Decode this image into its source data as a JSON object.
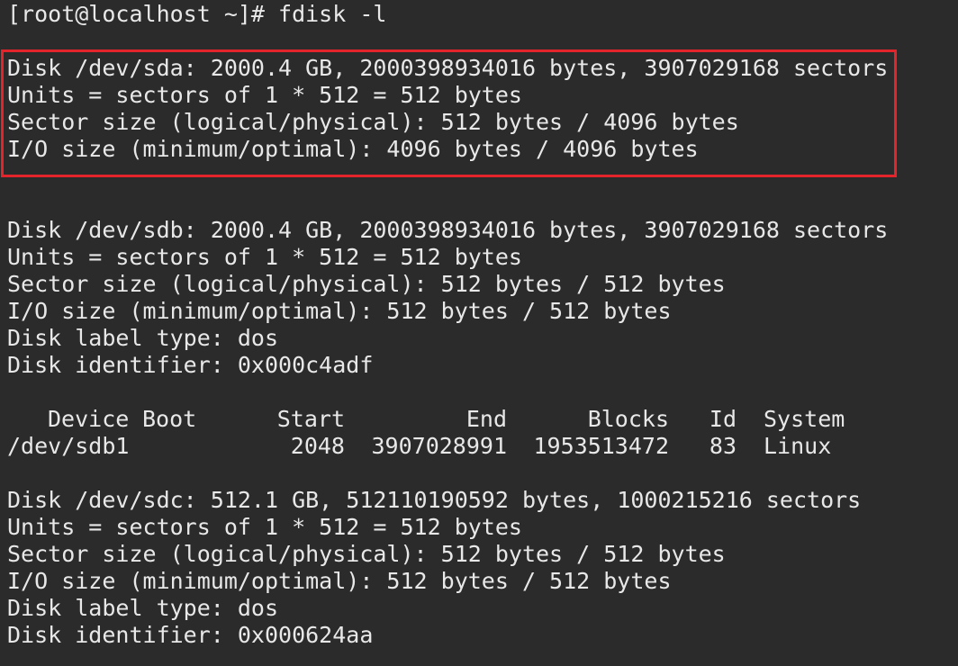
{
  "terminal": {
    "prompt": "[root@localhost ~]# fdisk -l",
    "highlight_color": "#e3242b",
    "sda": {
      "disk": "Disk /dev/sda: 2000.4 GB, 2000398934016 bytes, 3907029168 sectors",
      "units": "Units = sectors of 1 * 512 = 512 bytes",
      "sector_size": "Sector size (logical/physical): 512 bytes / 4096 bytes",
      "io_size": "I/O size (minimum/optimal): 4096 bytes / 4096 bytes"
    },
    "sdb": {
      "disk": "Disk /dev/sdb: 2000.4 GB, 2000398934016 bytes, 3907029168 sectors",
      "units": "Units = sectors of 1 * 512 = 512 bytes",
      "sector_size": "Sector size (logical/physical): 512 bytes / 512 bytes",
      "io_size": "I/O size (minimum/optimal): 512 bytes / 512 bytes",
      "label_type": "Disk label type: dos",
      "identifier": "Disk identifier: 0x000c4adf"
    },
    "partition_table": {
      "headers": {
        "device": "Device",
        "boot": "Boot",
        "start": "Start",
        "end": "End",
        "blocks": "Blocks",
        "id": "Id",
        "system": "System"
      },
      "rows": [
        {
          "device": "/dev/sdb1",
          "start": "2048",
          "end": "3907028991",
          "blocks": "1953513472",
          "id": "83",
          "system": "Linux"
        }
      ]
    },
    "sdc": {
      "disk": "Disk /dev/sdc: 512.1 GB, 512110190592 bytes, 1000215216 sectors",
      "units": "Units = sectors of 1 * 512 = 512 bytes",
      "sector_size": "Sector size (logical/physical): 512 bytes / 512 bytes",
      "io_size": "I/O size (minimum/optimal): 512 bytes / 512 bytes",
      "label_type": "Disk label type: dos",
      "identifier": "Disk identifier: 0x000624aa"
    }
  }
}
